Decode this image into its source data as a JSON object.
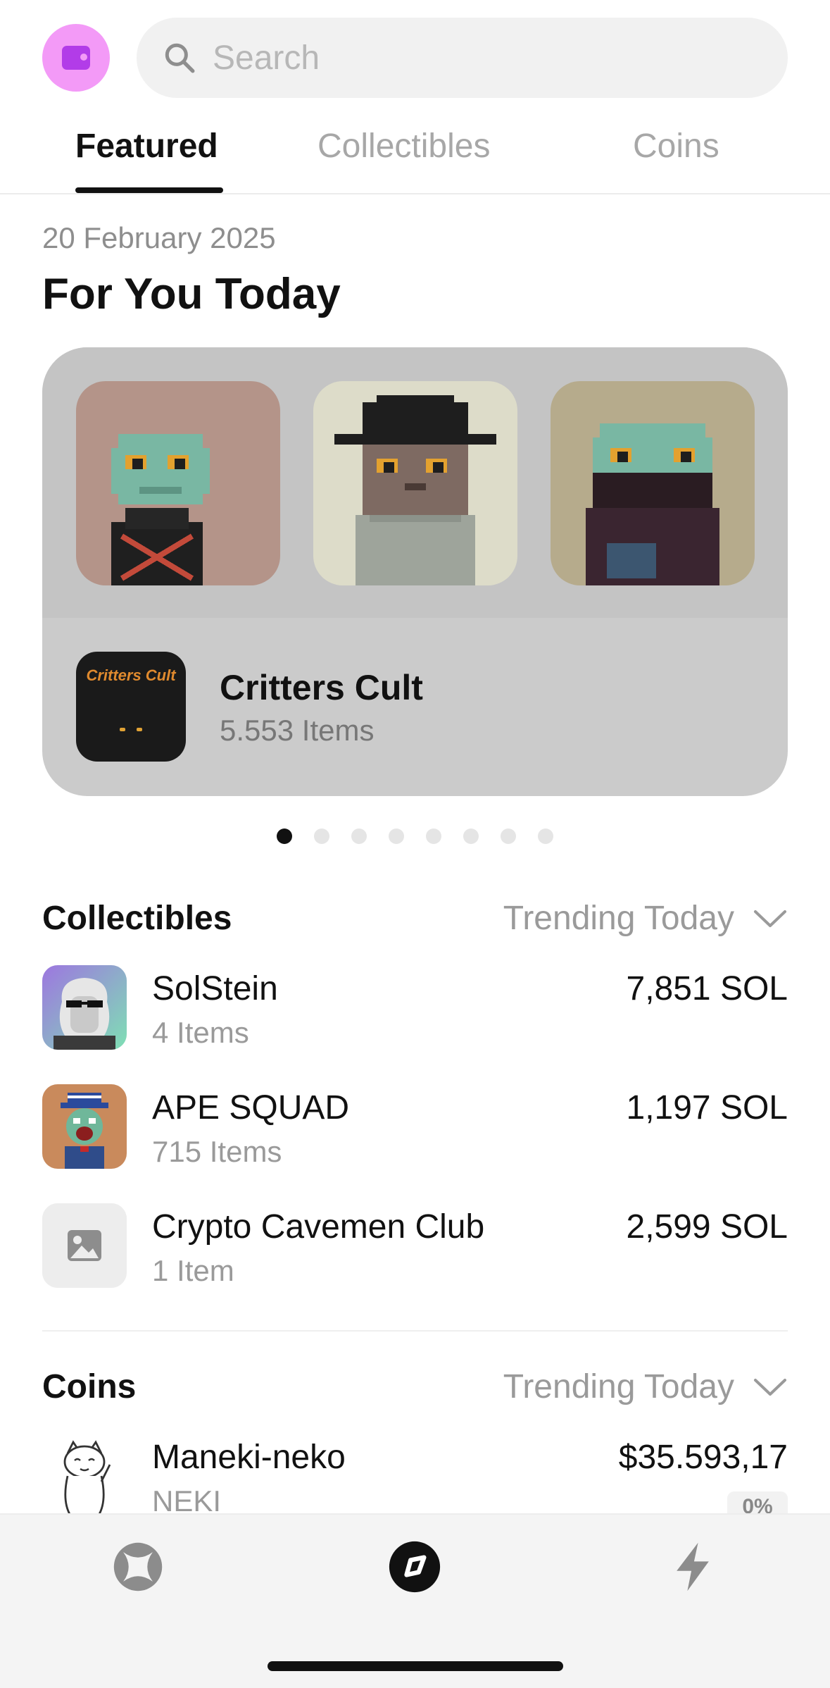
{
  "search": {
    "placeholder": "Search"
  },
  "tabs": [
    {
      "label": "Featured",
      "active": true
    },
    {
      "label": "Collectibles",
      "active": false
    },
    {
      "label": "Coins",
      "active": false
    }
  ],
  "featured": {
    "date": "20 February 2025",
    "heading": "For You Today",
    "collection": {
      "name": "Critters Cult",
      "items": "5.553 Items",
      "logo_text": "Critters Cult"
    },
    "carousel": {
      "page_count": 8,
      "active_index": 0
    }
  },
  "collectibles": {
    "title": "Collectibles",
    "sort": "Trending Today",
    "rows": [
      {
        "name": "SolStein",
        "sub": "4 Items",
        "value": "7,851 SOL"
      },
      {
        "name": "APE SQUAD",
        "sub": "715 Items",
        "value": "1,197 SOL"
      },
      {
        "name": "Crypto Cavemen Club",
        "sub": "1 Item",
        "value": "2,599 SOL"
      }
    ]
  },
  "coins": {
    "title": "Coins",
    "sort": "Trending Today",
    "rows": [
      {
        "name": "Maneki-neko",
        "sub": "NEKI",
        "value": "$35.593,17",
        "change": "0%"
      }
    ]
  },
  "colors": {
    "accent": "#111111",
    "avatar": "#f39af7",
    "wallet": "#b23ce8",
    "muted": "#9a9a9a"
  },
  "bottom_nav": [
    {
      "icon": "portfolio-icon",
      "active": false
    },
    {
      "icon": "explore-icon",
      "active": true
    },
    {
      "icon": "activity-bolt-icon",
      "active": false
    }
  ]
}
